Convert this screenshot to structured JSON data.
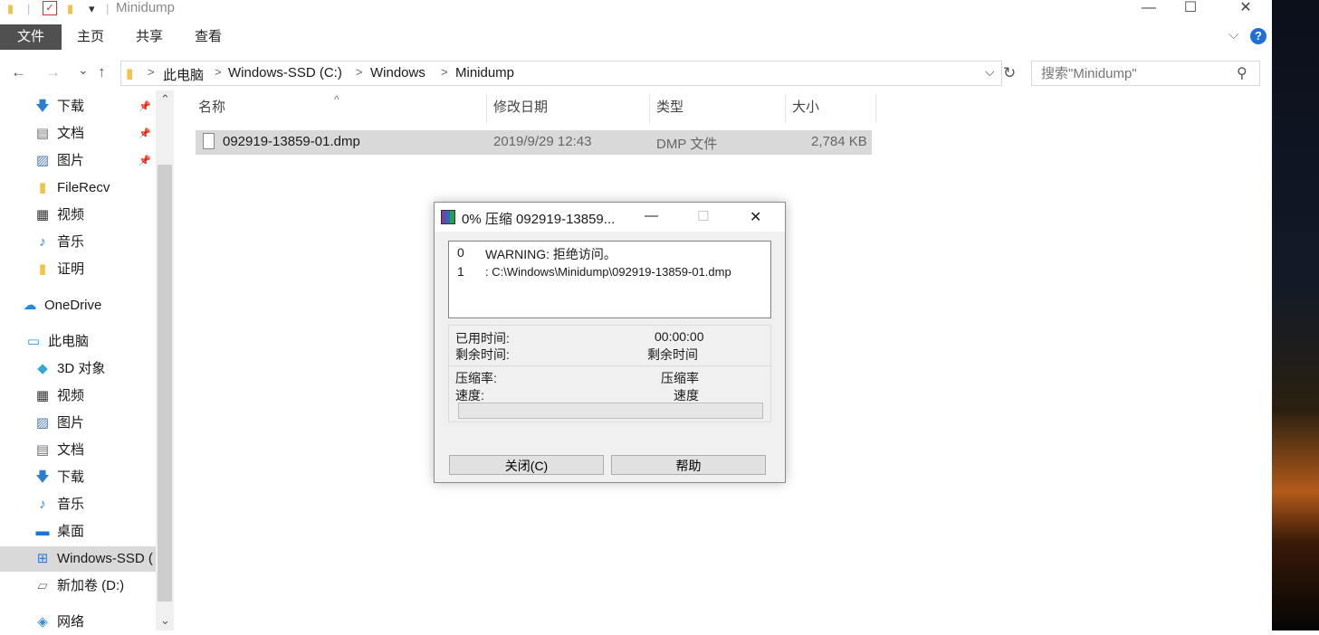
{
  "window": {
    "title": "Minidump",
    "controls": {
      "minimize": "—",
      "maximize": "☐",
      "close": "✕"
    },
    "qa_dropdown": "▾"
  },
  "ribbon": {
    "tabs": [
      "文件",
      "主页",
      "共享",
      "查看"
    ],
    "expand": "⌵",
    "help": "?"
  },
  "address": {
    "crumbs": [
      "此电脑",
      "Windows-SSD (C:)",
      "Windows",
      "Minidump"
    ],
    "separator": ">",
    "dropdown": "⌵",
    "refresh": "↻"
  },
  "search": {
    "placeholder": "搜索\"Minidump\"",
    "icon": "⚲"
  },
  "nav": {
    "back": "←",
    "forward": "→",
    "recent": "⌄",
    "up": "↑",
    "items": [
      {
        "label": "下载",
        "icon": "download-icon",
        "glyph": "🡇",
        "color": "#2b7cd3",
        "pinned": true
      },
      {
        "label": "文档",
        "icon": "document-icon",
        "glyph": "▤",
        "color": "#6d6d6d",
        "pinned": true
      },
      {
        "label": "图片",
        "icon": "pictures-icon",
        "glyph": "▨",
        "color": "#4a7ab8",
        "pinned": true
      },
      {
        "label": "FileRecv",
        "icon": "folder-icon",
        "glyph": "▮",
        "color": "#f3c04a",
        "pinned": false
      },
      {
        "label": "视频",
        "icon": "video-icon",
        "glyph": "▦",
        "color": "#333333",
        "pinned": false
      },
      {
        "label": "音乐",
        "icon": "music-icon",
        "glyph": "♪",
        "color": "#2b7cd3",
        "pinned": false
      },
      {
        "label": "证明",
        "icon": "folder-icon",
        "glyph": "▮",
        "color": "#f3c04a",
        "pinned": false
      },
      {
        "label": "OneDrive",
        "icon": "onedrive-icon",
        "glyph": "☁",
        "color": "#1e88e5",
        "pinned": false
      },
      {
        "label": "此电脑",
        "icon": "this-pc-icon",
        "glyph": "▭",
        "color": "#3a8fd8",
        "pinned": false
      },
      {
        "label": "3D 对象",
        "icon": "3d-objects-icon",
        "glyph": "◆",
        "color": "#35a7d8",
        "pinned": false
      },
      {
        "label": "视频",
        "icon": "video-icon",
        "glyph": "▦",
        "color": "#333333",
        "pinned": false
      },
      {
        "label": "图片",
        "icon": "pictures-icon",
        "glyph": "▨",
        "color": "#4a7ab8",
        "pinned": false
      },
      {
        "label": "文档",
        "icon": "document-icon",
        "glyph": "▤",
        "color": "#6d6d6d",
        "pinned": false
      },
      {
        "label": "下载",
        "icon": "download-icon",
        "glyph": "🡇",
        "color": "#2b7cd3",
        "pinned": false
      },
      {
        "label": "音乐",
        "icon": "music-icon",
        "glyph": "♪",
        "color": "#2b7cd3",
        "pinned": false
      },
      {
        "label": "桌面",
        "icon": "desktop-icon",
        "glyph": "▬",
        "color": "#1976d2",
        "pinned": false
      },
      {
        "label": "Windows-SSD (",
        "icon": "windows-drive-icon",
        "glyph": "⊞",
        "color": "#2b7cd3",
        "pinned": false
      },
      {
        "label": "新加卷 (D:)",
        "icon": "drive-icon",
        "glyph": "▱",
        "color": "#777777",
        "pinned": false
      },
      {
        "label": "网络",
        "icon": "network-icon",
        "glyph": "◈",
        "color": "#3a8fd8",
        "pinned": false
      }
    ],
    "pin_glyph": "📌",
    "scroll_up": "⌃",
    "scroll_down": "⌄"
  },
  "columns": {
    "sort_indicator": "^",
    "headers": [
      "名称",
      "修改日期",
      "类型",
      "大小"
    ]
  },
  "files": [
    {
      "name": "092919-13859-01.dmp",
      "modified": "2019/9/29 12:43",
      "type": "DMP 文件",
      "size": "2,784 KB"
    }
  ],
  "dialog": {
    "title": "0% 压缩 092919-13859...",
    "log": [
      {
        "num": "0",
        "msg": "WARNING: 拒绝访问。"
      },
      {
        "num": "1",
        "msg": ": C:\\Windows\\Minidump\\092919-13859-01.dmp"
      }
    ],
    "elapsed_label": "已用时间:",
    "elapsed_value": "00:00:00",
    "remaining_label": "剩余时间:",
    "remaining_value": "剩余时间",
    "ratio_label": "压缩率:",
    "ratio_value": "压缩率",
    "speed_label": "速度:",
    "speed_value": "速度",
    "progress": 0,
    "close_button": "关闭(C)",
    "help_button": "帮助",
    "controls": {
      "minimize": "—",
      "maximize": "☐",
      "close": "✕"
    }
  }
}
